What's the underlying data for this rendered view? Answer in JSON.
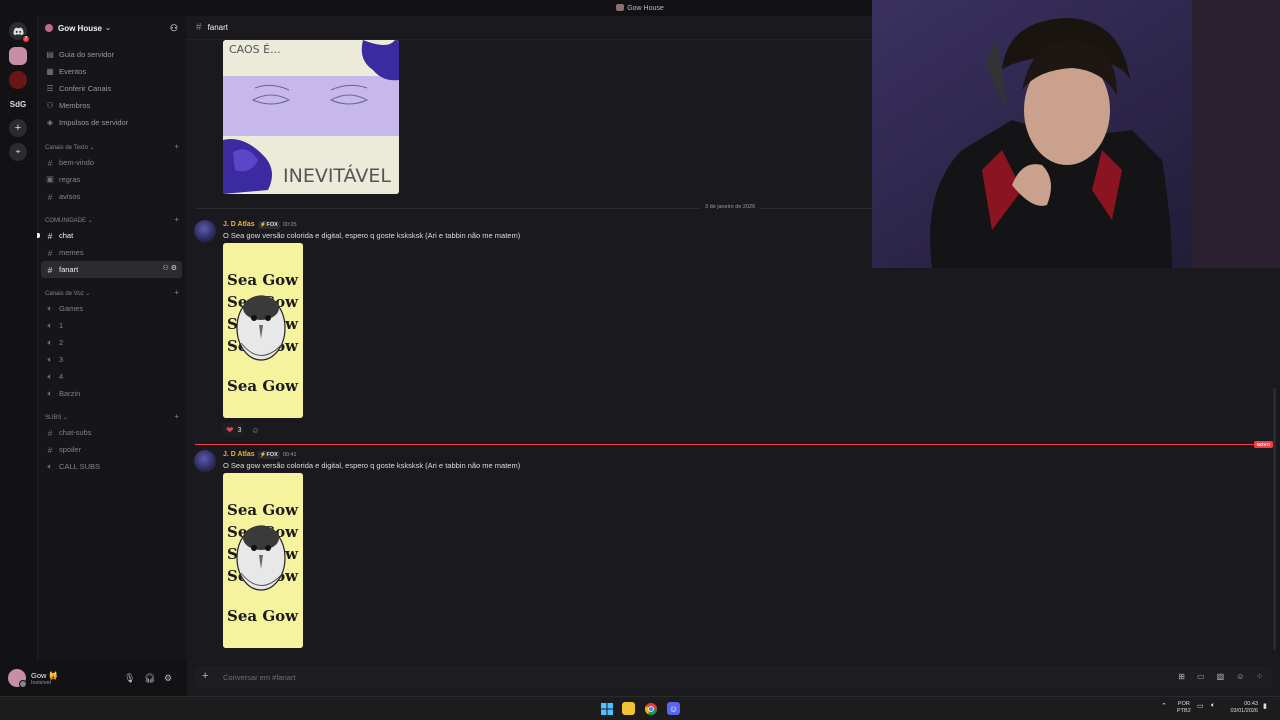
{
  "window": {
    "title": "Gow House"
  },
  "rail": {
    "home_badge": "7",
    "server_label": "SdG",
    "add_label": "+",
    "discover_label": "⌖"
  },
  "server": {
    "name": "Gow House"
  },
  "nav": [
    {
      "label": "Guia do servidor",
      "icon": "guide-icon"
    },
    {
      "label": "Eventos",
      "icon": "calendar-icon"
    },
    {
      "label": "Conferir Canais",
      "icon": "browse-channels-icon"
    },
    {
      "label": "Membros",
      "icon": "members-icon"
    },
    {
      "label": "Impulsos de servidor",
      "icon": "boost-icon"
    }
  ],
  "categories": {
    "text": {
      "label": "Canais de Texto",
      "channels": [
        "bem-vindo",
        "regras",
        "avisos"
      ]
    },
    "community": {
      "label": "COMUNIDADE",
      "channels": [
        "chat",
        "memes",
        "fanart"
      ]
    },
    "voice": {
      "label": "Canais de Voz",
      "channels": [
        "Games",
        "1",
        "2",
        "3",
        "4",
        "Barzin"
      ]
    },
    "subs": {
      "label": "SUBS",
      "channels": [
        "chat-subs",
        "spoiler",
        "CALL SUBS"
      ]
    }
  },
  "user": {
    "name": "Gow",
    "emoji": "🙀",
    "status": "Invisível"
  },
  "channel": {
    "name": "fanart"
  },
  "image_caos": {
    "top_text": "CAOS É...",
    "bottom_text": "INEVITÁVEL"
  },
  "date_divider": "3 de janeiro de 2026",
  "messages": [
    {
      "author": "J. D Atlas",
      "tag": "FOX",
      "time": "00:25",
      "text": "O Sea gow versão colorida e digital, espero q goste ksksksk (Ari e tabbin não me matem)",
      "image_text": "Sea Gow",
      "reaction": {
        "emoji": "❤",
        "count": "3"
      }
    },
    {
      "author": "J. D Atlas",
      "tag": "FOX",
      "time": "00:41",
      "text": "O Sea gow versão colorida e digital, espero q goste ksksksk (Ari e tabbin não me matem)",
      "image_text": "Sea Gow"
    }
  ],
  "new_badge": "NOVO",
  "composer": {
    "placeholder": "Conversar em #fanart"
  },
  "taskbar": {
    "lang1": "POR",
    "lang2": "PTB2",
    "time": "00:43",
    "date": "03/01/2026"
  },
  "colors": {
    "accent": "#f0b232",
    "unread_line": "#f23f43",
    "background": "#1a1a1e"
  }
}
